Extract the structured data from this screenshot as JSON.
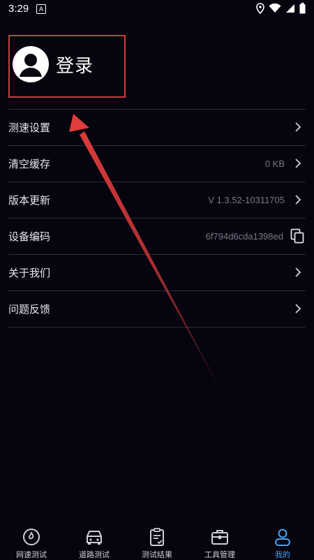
{
  "status": {
    "time": "3:29",
    "notif_icon": "A"
  },
  "profile": {
    "login_label": "登录"
  },
  "menu": [
    {
      "label": "测速设置",
      "value": "",
      "action": "chevron"
    },
    {
      "label": "清空缓存",
      "value": "0 KB",
      "action": "chevron"
    },
    {
      "label": "版本更新",
      "value": "V 1.3.52-10311705",
      "action": "chevron"
    },
    {
      "label": "设备编码",
      "value": "6f794d6cda1398ed",
      "action": "copy"
    },
    {
      "label": "关于我们",
      "value": "",
      "action": "chevron"
    },
    {
      "label": "问题反馈",
      "value": "",
      "action": "chevron"
    }
  ],
  "tabs": [
    {
      "label": "网速测试",
      "icon": "speedometer-icon",
      "active": false
    },
    {
      "label": "道路测试",
      "icon": "car-icon",
      "active": false
    },
    {
      "label": "测试结果",
      "icon": "clipboard-icon",
      "active": false
    },
    {
      "label": "工具管理",
      "icon": "toolbox-icon",
      "active": false
    },
    {
      "label": "我的",
      "icon": "user-icon",
      "active": true
    }
  ],
  "colors": {
    "background": "#05040f",
    "accent": "#4aa3f0",
    "highlight": "#d63a3a"
  }
}
